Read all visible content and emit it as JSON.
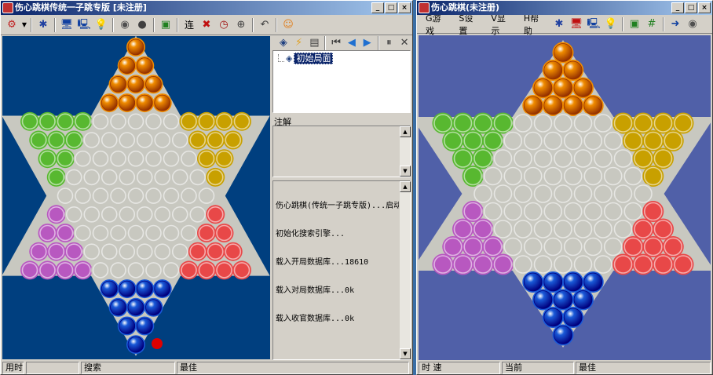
{
  "left_window": {
    "title": "伤心跳棋传统一子跳专版 [未注册]",
    "buttons": {
      "minimize": "_",
      "maximize": "□",
      "close": "×"
    },
    "toolbar": {
      "icons": [
        "menu-icon",
        "star-icon",
        "computer-icon",
        "computer2-icon",
        "bulb-icon",
        "globe-icon",
        "ball-icon",
        "export-icon",
        "connect-icon",
        "stop-icon",
        "clock-icon",
        "zoom-icon",
        "undo-icon",
        "person-icon"
      ],
      "connect_label": "连"
    },
    "right_toolbar_icons": [
      "open-icon",
      "bolt-icon",
      "save-icon",
      "first-icon",
      "back-icon",
      "forward-icon",
      "pause-icon",
      "delete-icon"
    ],
    "tree": {
      "root": "初始局面"
    },
    "notes_label": "注解",
    "log_lines": [
      "伤心跳棋(传统一子跳专版)...启动",
      "初始化搜索引擎...",
      "载入开局数据库...18610",
      "载入对局数据库...0k",
      "载入收官数据库...0k"
    ],
    "status": {
      "time": "用时",
      "search": "搜索",
      "best": "最佳"
    }
  },
  "right_window": {
    "title": "伤心跳棋(未注册)",
    "buttons": {
      "minimize": "_",
      "maximize": "□",
      "close": "×"
    },
    "menu": [
      "G游戏",
      "S设置",
      "V显示",
      "H帮助"
    ],
    "status": {
      "time": "时 速",
      "current": "当前",
      "best": "最佳"
    }
  },
  "colors": {
    "left_board_bg": "#003f7f",
    "right_board_bg": "#5060a8",
    "hex_fill": "#c8c8c0",
    "orange": "#f08c00",
    "yellow": "#c8a000",
    "green": "#58b830",
    "purple": "#b858c0",
    "red": "#e84848",
    "blue": "#1a5ad8",
    "selection_dot": "#e00000"
  }
}
